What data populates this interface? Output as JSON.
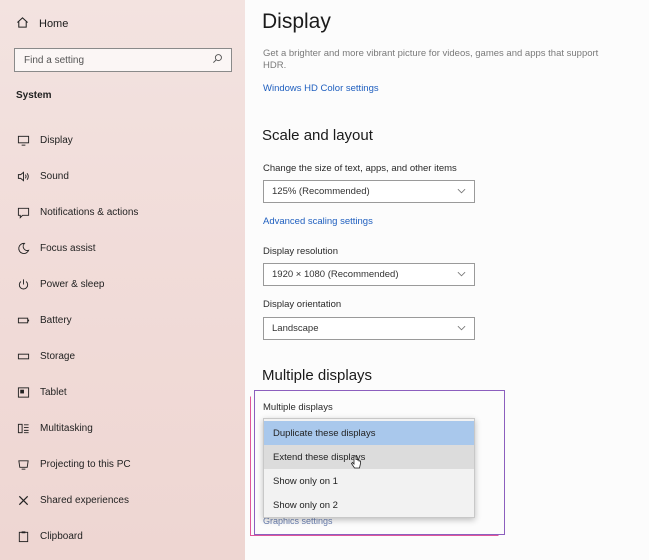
{
  "sidebar": {
    "home_label": "Home",
    "search_placeholder": "Find a setting",
    "section": "System",
    "items": [
      {
        "label": "Display",
        "icon": "monitor-icon"
      },
      {
        "label": "Sound",
        "icon": "speaker-icon"
      },
      {
        "label": "Notifications & actions",
        "icon": "notification-icon"
      },
      {
        "label": "Focus assist",
        "icon": "moon-icon"
      },
      {
        "label": "Power & sleep",
        "icon": "power-icon"
      },
      {
        "label": "Battery",
        "icon": "battery-icon"
      },
      {
        "label": "Storage",
        "icon": "storage-icon"
      },
      {
        "label": "Tablet",
        "icon": "tablet-icon"
      },
      {
        "label": "Multitasking",
        "icon": "multitasking-icon"
      },
      {
        "label": "Projecting to this PC",
        "icon": "projecting-icon"
      },
      {
        "label": "Shared experiences",
        "icon": "shared-icon"
      },
      {
        "label": "Clipboard",
        "icon": "clipboard-icon"
      }
    ]
  },
  "main": {
    "title": "Display",
    "hdr_description": "Get a brighter and more vibrant picture for videos, games and apps that support HDR.",
    "hdr_link": "Windows HD Color settings",
    "scale_heading": "Scale and layout",
    "scale_label": "Change the size of text, apps, and other items",
    "scale_value": "125% (Recommended)",
    "advanced_scaling_link": "Advanced scaling settings",
    "resolution_label": "Display resolution",
    "resolution_value": "1920 × 1080 (Recommended)",
    "orientation_label": "Display orientation",
    "orientation_value": "Landscape",
    "multiple_heading": "Multiple displays",
    "multiple_label": "Multiple displays",
    "multiple_options": [
      "Duplicate these displays",
      "Extend these displays",
      "Show only on 1",
      "Show only on 2"
    ],
    "graphics_link_partial": "Graphics settings"
  },
  "colors": {
    "sidebar_bg": "#f1dcd9",
    "link": "#1f5fbf",
    "selected_option": "#a9c8ec",
    "frame_purple": "#8c5fbe",
    "frame_pink": "#e0569a"
  }
}
